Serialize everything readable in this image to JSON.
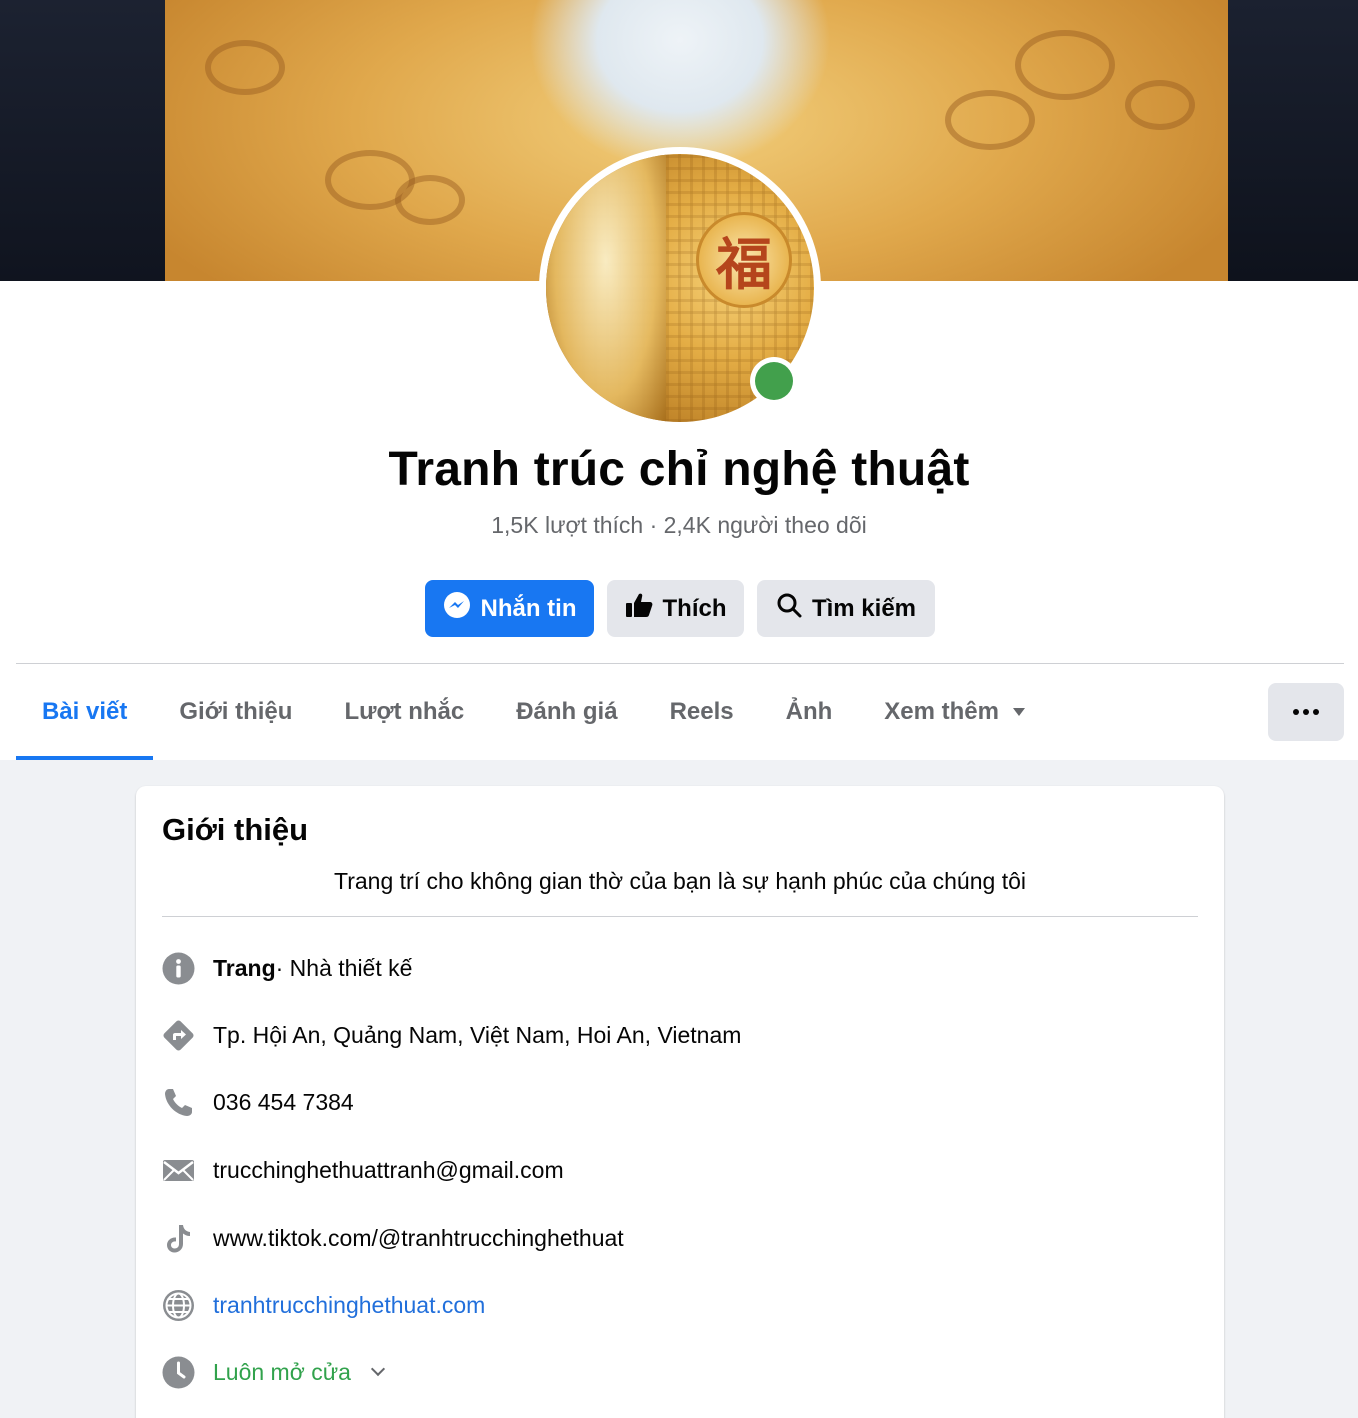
{
  "page": {
    "name": "Tranh trúc chỉ nghệ thuật",
    "stats": "1,5K lượt thích · 2,4K người theo dõi",
    "avatar_glyph": "福"
  },
  "actions": {
    "message_label": "Nhắn tin",
    "like_label": "Thích",
    "search_label": "Tìm kiếm"
  },
  "tabs": [
    {
      "label": "Bài viết",
      "active": true
    },
    {
      "label": "Giới thiệu"
    },
    {
      "label": "Lượt nhắc"
    },
    {
      "label": "Đánh giá"
    },
    {
      "label": "Reels"
    },
    {
      "label": "Ảnh"
    },
    {
      "label": "Xem thêm"
    }
  ],
  "intro": {
    "title": "Giới thiệu",
    "bio": "Trang trí cho không gian thờ của bạn là sự hạnh phúc của chúng tôi",
    "category_prefix": "Trang",
    "category": " · Nhà thiết kế",
    "address": "Tp. Hội An, Quảng Nam, Việt Nam, Hoi An, Vietnam",
    "phone": "036 454 7384",
    "email": "trucchinghethuattranh@gmail.com",
    "tiktok": "www.tiktok.com/@tranhtrucchinghethuat",
    "website": "tranhtrucchinghethuat.com",
    "hours": "Luôn mở cửa"
  },
  "icons": {
    "info": "info-icon",
    "directions": "directions-icon",
    "phone": "phone-icon",
    "email": "envelope-icon",
    "tiktok": "tiktok-icon",
    "website": "globe-icon",
    "hours": "clock-icon"
  },
  "colors": {
    "accent": "#1877f2",
    "link": "#216fdb",
    "open": "#31a24c",
    "online": "#42a04c",
    "secondary_text": "#65676b",
    "background": "#f0f2f5"
  }
}
